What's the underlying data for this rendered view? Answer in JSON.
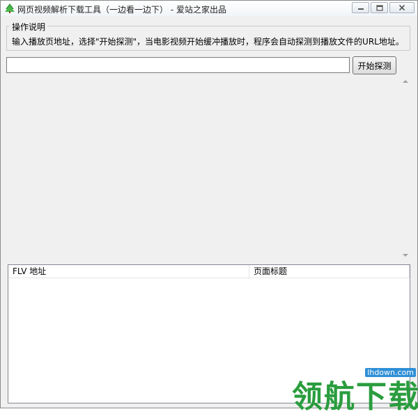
{
  "window": {
    "title": "网页视频解析下载工具（一边看一边下） - 爱站之家出品"
  },
  "instructions": {
    "legend": "操作说明",
    "description": "输入播放页地址，选择\"开始探测\"，当电影视频开始缓冲播放时，程序会自动探测到播放文件的URL地址。"
  },
  "url_input": {
    "value": "",
    "placeholder": ""
  },
  "start_button": {
    "label": "开始探测"
  },
  "results_table": {
    "columns": [
      "FLV 地址",
      "页面标题"
    ],
    "rows": []
  },
  "watermark": {
    "site": "lhdown.com",
    "text": "领航下载"
  },
  "colors": {
    "window_bg": "#f0f0f0",
    "watermark_green": "#2a9d3e",
    "watermark_blue": "#2f8fd6"
  }
}
